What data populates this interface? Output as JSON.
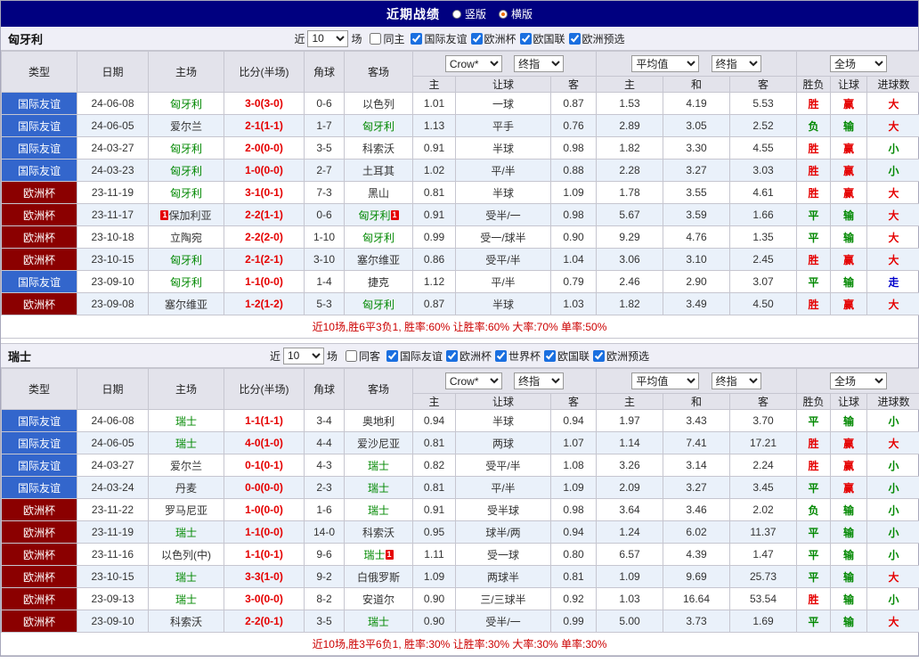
{
  "title_bar": {
    "title": "近期战绩",
    "options": [
      {
        "label": "竖版",
        "selected": false
      },
      {
        "label": "横版",
        "selected": true
      }
    ]
  },
  "table_header": {
    "type": "类型",
    "date": "日期",
    "home": "主场",
    "score": "比分(半场)",
    "corner": "角球",
    "away": "客场",
    "odds_source": "Crow*",
    "odds_time": "终指",
    "avg_source": "平均值",
    "avg_time": "终指",
    "scope": "全场",
    "sub_odds_home": "主",
    "sub_odds_handicap": "让球",
    "sub_odds_away": "客",
    "sub_avg_home": "主",
    "sub_avg_draw": "和",
    "sub_avg_away": "客",
    "sub_result": "胜负",
    "sub_handicap_result": "让球",
    "sub_goals": "进球数"
  },
  "sections": [
    {
      "team": "匈牙利",
      "filter": {
        "near_label": "近",
        "count": "10",
        "games_label": "场",
        "same_venue": {
          "label": "同主",
          "checked": false
        },
        "leagues": [
          {
            "label": "国际友谊",
            "checked": true
          },
          {
            "label": "欧洲杯",
            "checked": true
          },
          {
            "label": "欧国联",
            "checked": true
          },
          {
            "label": "欧洲预选",
            "checked": true
          }
        ]
      },
      "rows": [
        {
          "league": "国际友谊",
          "date": "24-06-08",
          "home": "匈牙利",
          "home_card": "",
          "score": "3-0(3-0)",
          "corner": "0-6",
          "away": "以色列",
          "away_card": "",
          "odds_home": "1.01",
          "handicap": "一球",
          "odds_away": "0.87",
          "avg_home": "1.53",
          "avg_draw": "4.19",
          "avg_away": "5.53",
          "result": "胜",
          "handicap_result": "赢",
          "goals": "大"
        },
        {
          "league": "国际友谊",
          "date": "24-06-05",
          "home": "爱尔兰",
          "home_card": "",
          "score": "2-1(1-1)",
          "corner": "1-7",
          "away": "匈牙利",
          "away_card": "",
          "odds_home": "1.13",
          "handicap": "平手",
          "odds_away": "0.76",
          "avg_home": "2.89",
          "avg_draw": "3.05",
          "avg_away": "2.52",
          "result": "负",
          "handicap_result": "输",
          "goals": "大"
        },
        {
          "league": "国际友谊",
          "date": "24-03-27",
          "home": "匈牙利",
          "home_card": "",
          "score": "2-0(0-0)",
          "corner": "3-5",
          "away": "科索沃",
          "away_card": "",
          "odds_home": "0.91",
          "handicap": "半球",
          "odds_away": "0.98",
          "avg_home": "1.82",
          "avg_draw": "3.30",
          "avg_away": "4.55",
          "result": "胜",
          "handicap_result": "赢",
          "goals": "小"
        },
        {
          "league": "国际友谊",
          "date": "24-03-23",
          "home": "匈牙利",
          "home_card": "",
          "score": "1-0(0-0)",
          "corner": "2-7",
          "away": "土耳其",
          "away_card": "",
          "odds_home": "1.02",
          "handicap": "平/半",
          "odds_away": "0.88",
          "avg_home": "2.28",
          "avg_draw": "3.27",
          "avg_away": "3.03",
          "result": "胜",
          "handicap_result": "赢",
          "goals": "小"
        },
        {
          "league": "欧洲杯",
          "date": "23-11-19",
          "home": "匈牙利",
          "home_card": "",
          "score": "3-1(0-1)",
          "corner": "7-3",
          "away": "黑山",
          "away_card": "",
          "odds_home": "0.81",
          "handicap": "半球",
          "odds_away": "1.09",
          "avg_home": "1.78",
          "avg_draw": "3.55",
          "avg_away": "4.61",
          "result": "胜",
          "handicap_result": "赢",
          "goals": "大"
        },
        {
          "league": "欧洲杯",
          "date": "23-11-17",
          "home": "保加利亚",
          "home_card": "1",
          "score": "2-2(1-1)",
          "corner": "0-6",
          "away": "匈牙利",
          "away_card": "1",
          "odds_home": "0.91",
          "handicap": "受半/一",
          "odds_away": "0.98",
          "avg_home": "5.67",
          "avg_draw": "3.59",
          "avg_away": "1.66",
          "result": "平",
          "handicap_result": "输",
          "goals": "大"
        },
        {
          "league": "欧洲杯",
          "date": "23-10-18",
          "home": "立陶宛",
          "home_card": "",
          "score": "2-2(2-0)",
          "corner": "1-10",
          "away": "匈牙利",
          "away_card": "",
          "odds_home": "0.99",
          "handicap": "受一/球半",
          "odds_away": "0.90",
          "avg_home": "9.29",
          "avg_draw": "4.76",
          "avg_away": "1.35",
          "result": "平",
          "handicap_result": "输",
          "goals": "大"
        },
        {
          "league": "欧洲杯",
          "date": "23-10-15",
          "home": "匈牙利",
          "home_card": "",
          "score": "2-1(2-1)",
          "corner": "3-10",
          "away": "塞尔维亚",
          "away_card": "",
          "odds_home": "0.86",
          "handicap": "受平/半",
          "odds_away": "1.04",
          "avg_home": "3.06",
          "avg_draw": "3.10",
          "avg_away": "2.45",
          "result": "胜",
          "handicap_result": "赢",
          "goals": "大"
        },
        {
          "league": "国际友谊",
          "date": "23-09-10",
          "home": "匈牙利",
          "home_card": "",
          "score": "1-1(0-0)",
          "corner": "1-4",
          "away": "捷克",
          "away_card": "",
          "odds_home": "1.12",
          "handicap": "平/半",
          "odds_away": "0.79",
          "avg_home": "2.46",
          "avg_draw": "2.90",
          "avg_away": "3.07",
          "result": "平",
          "handicap_result": "输",
          "goals": "走"
        },
        {
          "league": "欧洲杯",
          "date": "23-09-08",
          "home": "塞尔维亚",
          "home_card": "",
          "score": "1-2(1-2)",
          "corner": "5-3",
          "away": "匈牙利",
          "away_card": "",
          "odds_home": "0.87",
          "handicap": "半球",
          "odds_away": "1.03",
          "avg_home": "1.82",
          "avg_draw": "3.49",
          "avg_away": "4.50",
          "result": "胜",
          "handicap_result": "赢",
          "goals": "大"
        }
      ],
      "summary": "近10场,胜6平3负1, 胜率:60% 让胜率:60% 大率:70% 单率:50%"
    },
    {
      "team": "瑞士",
      "filter": {
        "near_label": "近",
        "count": "10",
        "games_label": "场",
        "same_venue": {
          "label": "同客",
          "checked": false
        },
        "leagues": [
          {
            "label": "国际友谊",
            "checked": true
          },
          {
            "label": "欧洲杯",
            "checked": true
          },
          {
            "label": "世界杯",
            "checked": true
          },
          {
            "label": "欧国联",
            "checked": true
          },
          {
            "label": "欧洲预选",
            "checked": true
          }
        ]
      },
      "rows": [
        {
          "league": "国际友谊",
          "date": "24-06-08",
          "home": "瑞士",
          "home_card": "",
          "score": "1-1(1-1)",
          "corner": "3-4",
          "away": "奥地利",
          "away_card": "",
          "odds_home": "0.94",
          "handicap": "半球",
          "odds_away": "0.94",
          "avg_home": "1.97",
          "avg_draw": "3.43",
          "avg_away": "3.70",
          "result": "平",
          "handicap_result": "输",
          "goals": "小"
        },
        {
          "league": "国际友谊",
          "date": "24-06-05",
          "home": "瑞士",
          "home_card": "",
          "score": "4-0(1-0)",
          "corner": "4-4",
          "away": "爱沙尼亚",
          "away_card": "",
          "odds_home": "0.81",
          "handicap": "两球",
          "odds_away": "1.07",
          "avg_home": "1.14",
          "avg_draw": "7.41",
          "avg_away": "17.21",
          "result": "胜",
          "handicap_result": "赢",
          "goals": "大"
        },
        {
          "league": "国际友谊",
          "date": "24-03-27",
          "home": "爱尔兰",
          "home_card": "",
          "score": "0-1(0-1)",
          "corner": "4-3",
          "away": "瑞士",
          "away_card": "",
          "odds_home": "0.82",
          "handicap": "受平/半",
          "odds_away": "1.08",
          "avg_home": "3.26",
          "avg_draw": "3.14",
          "avg_away": "2.24",
          "result": "胜",
          "handicap_result": "赢",
          "goals": "小"
        },
        {
          "league": "国际友谊",
          "date": "24-03-24",
          "home": "丹麦",
          "home_card": "",
          "score": "0-0(0-0)",
          "corner": "2-3",
          "away": "瑞士",
          "away_card": "",
          "odds_home": "0.81",
          "handicap": "平/半",
          "odds_away": "1.09",
          "avg_home": "2.09",
          "avg_draw": "3.27",
          "avg_away": "3.45",
          "result": "平",
          "handicap_result": "赢",
          "goals": "小"
        },
        {
          "league": "欧洲杯",
          "date": "23-11-22",
          "home": "罗马尼亚",
          "home_card": "",
          "score": "1-0(0-0)",
          "corner": "1-6",
          "away": "瑞士",
          "away_card": "",
          "odds_home": "0.91",
          "handicap": "受半球",
          "odds_away": "0.98",
          "avg_home": "3.64",
          "avg_draw": "3.46",
          "avg_away": "2.02",
          "result": "负",
          "handicap_result": "输",
          "goals": "小"
        },
        {
          "league": "欧洲杯",
          "date": "23-11-19",
          "home": "瑞士",
          "home_card": "",
          "score": "1-1(0-0)",
          "corner": "14-0",
          "away": "科索沃",
          "away_card": "",
          "odds_home": "0.95",
          "handicap": "球半/两",
          "odds_away": "0.94",
          "avg_home": "1.24",
          "avg_draw": "6.02",
          "avg_away": "11.37",
          "result": "平",
          "handicap_result": "输",
          "goals": "小"
        },
        {
          "league": "欧洲杯",
          "date": "23-11-16",
          "home": "以色列(中)",
          "home_card": "",
          "score": "1-1(0-1)",
          "corner": "9-6",
          "away": "瑞士",
          "away_card": "1",
          "odds_home": "1.11",
          "handicap": "受一球",
          "odds_away": "0.80",
          "avg_home": "6.57",
          "avg_draw": "4.39",
          "avg_away": "1.47",
          "result": "平",
          "handicap_result": "输",
          "goals": "小"
        },
        {
          "league": "欧洲杯",
          "date": "23-10-15",
          "home": "瑞士",
          "home_card": "",
          "score": "3-3(1-0)",
          "corner": "9-2",
          "away": "白俄罗斯",
          "away_card": "",
          "odds_home": "1.09",
          "handicap": "两球半",
          "odds_away": "0.81",
          "avg_home": "1.09",
          "avg_draw": "9.69",
          "avg_away": "25.73",
          "result": "平",
          "handicap_result": "输",
          "goals": "大"
        },
        {
          "league": "欧洲杯",
          "date": "23-09-13",
          "home": "瑞士",
          "home_card": "",
          "score": "3-0(0-0)",
          "corner": "8-2",
          "away": "安道尔",
          "away_card": "",
          "odds_home": "0.90",
          "handicap": "三/三球半",
          "odds_away": "0.92",
          "avg_home": "1.03",
          "avg_draw": "16.64",
          "avg_away": "53.54",
          "result": "胜",
          "handicap_result": "输",
          "goals": "小"
        },
        {
          "league": "欧洲杯",
          "date": "23-09-10",
          "home": "科索沃",
          "home_card": "",
          "score": "2-2(0-1)",
          "corner": "3-5",
          "away": "瑞士",
          "away_card": "",
          "odds_home": "0.90",
          "handicap": "受半/一",
          "odds_away": "0.99",
          "avg_home": "5.00",
          "avg_draw": "3.73",
          "avg_away": "1.69",
          "result": "平",
          "handicap_result": "输",
          "goals": "大"
        }
      ],
      "summary": "近10场,胜3平6负1, 胜率:30% 让胜率:30% 大率:30% 单率:30%"
    }
  ]
}
